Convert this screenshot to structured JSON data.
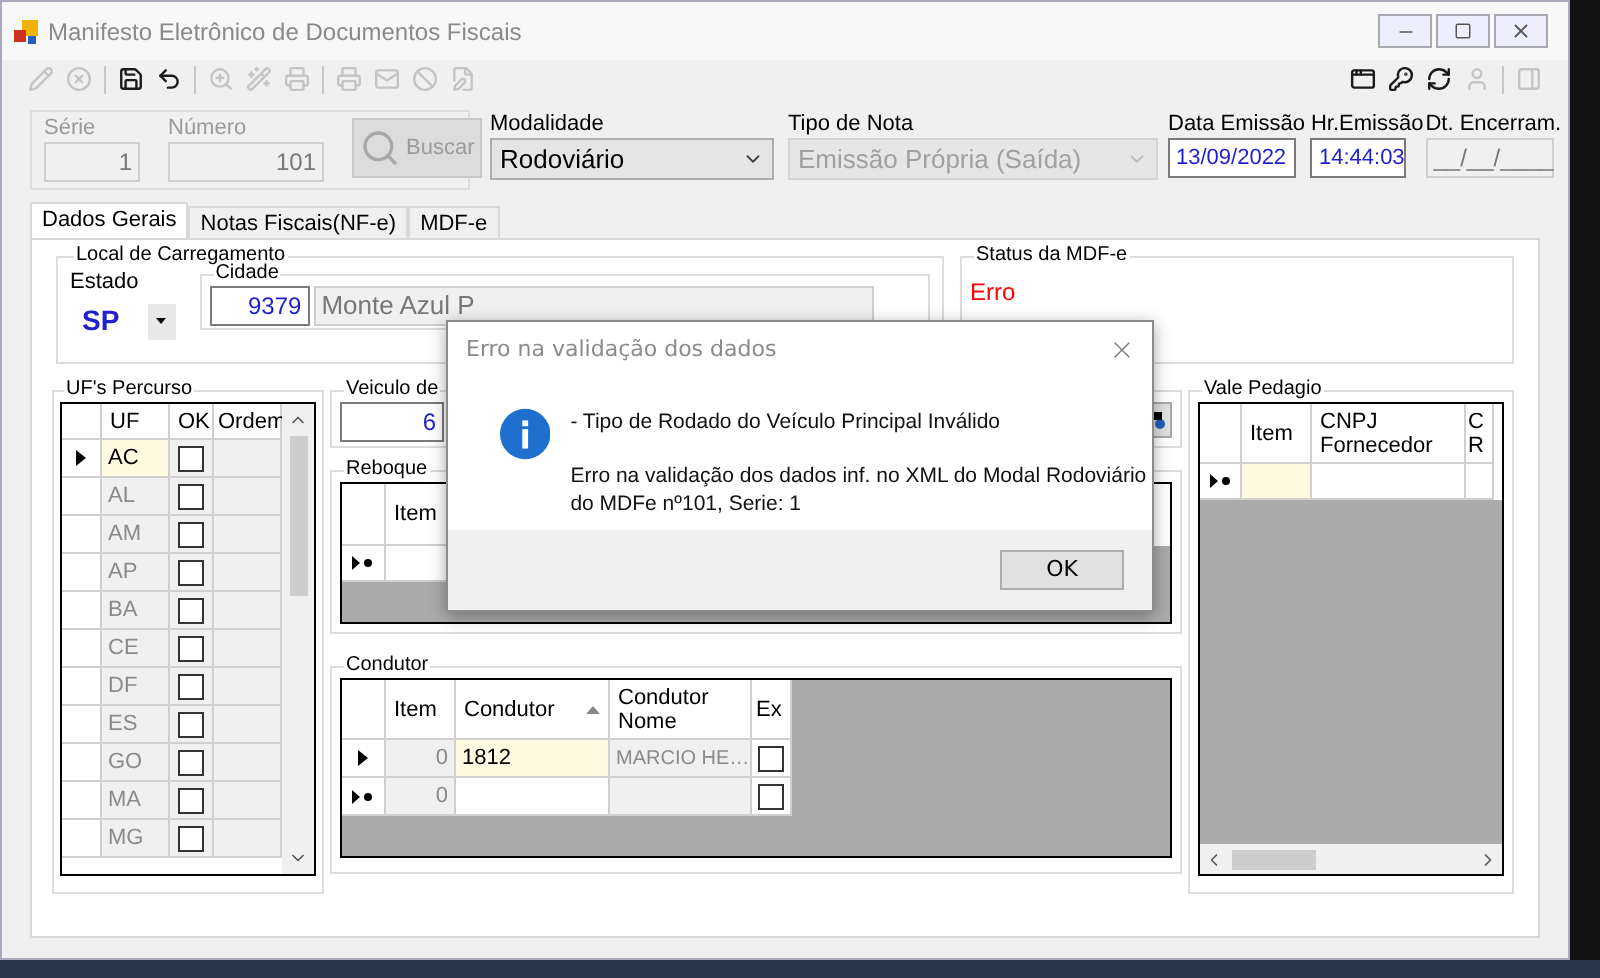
{
  "window": {
    "title": "Manifesto Eletrônico de Documentos Fiscais"
  },
  "toolbar": [
    {
      "kind": "edit",
      "disabled": true
    },
    {
      "kind": "cancel",
      "disabled": true
    },
    {
      "kind": "separator"
    },
    {
      "kind": "save",
      "disabled": false
    },
    {
      "kind": "undo",
      "disabled": false
    },
    {
      "kind": "separator"
    },
    {
      "kind": "zoom",
      "disabled": true
    },
    {
      "kind": "wand",
      "disabled": true
    },
    {
      "kind": "print",
      "disabled": true
    },
    {
      "kind": "separator"
    },
    {
      "kind": "print",
      "disabled": true
    },
    {
      "kind": "mail",
      "disabled": true
    },
    {
      "kind": "ban",
      "disabled": true
    },
    {
      "kind": "note",
      "disabled": true
    }
  ],
  "toolbar_right": [
    {
      "kind": "window",
      "disabled": false
    },
    {
      "kind": "key",
      "disabled": false
    },
    {
      "kind": "refresh",
      "disabled": false
    },
    {
      "kind": "user",
      "disabled": true
    },
    {
      "kind": "separator"
    },
    {
      "kind": "panel",
      "disabled": true
    }
  ],
  "header": {
    "serie": {
      "label": "Série",
      "value": "1",
      "disabled": true
    },
    "numero": {
      "label": "Número",
      "value": "101",
      "disabled": true
    },
    "search_button": {
      "label": "Buscar",
      "disabled": true
    },
    "modalidade": {
      "label": "Modalidade",
      "value": "Rodoviário",
      "disabled": false
    },
    "tipo_nota": {
      "label": "Tipo de Nota",
      "value": "Emissão Própria (Saída)",
      "disabled": true
    },
    "data_emissao": {
      "label": "Data Emissão",
      "value": "13/09/2022"
    },
    "hr_emissao": {
      "label": "Hr.Emissão",
      "value": "14:44:03"
    },
    "dt_encerram": {
      "label": "Dt. Encerram.",
      "value": "__/__/____"
    }
  },
  "tabs": [
    {
      "label": "Dados Gerais",
      "selected": true
    },
    {
      "label": "Notas Fiscais(NF-e)",
      "selected": false
    },
    {
      "label": "MDF-e",
      "selected": false
    }
  ],
  "local_carregamento": {
    "title": "Local de Carregamento",
    "estado_label": "Estado",
    "estado": "SP",
    "cidade_label": "Cidade",
    "cidade_code": "9379",
    "cidade_name": "Monte Azul P"
  },
  "status": {
    "title": "Status da MDF-e",
    "value": "Erro"
  },
  "ufs_percurso": {
    "title": "UF's Percurso",
    "columns": [
      "UF",
      "OK",
      "Ordem"
    ],
    "rows": [
      {
        "uf": "AC",
        "checked": false,
        "selected": true
      },
      {
        "uf": "AL",
        "checked": false,
        "selected": false
      },
      {
        "uf": "AM",
        "checked": false,
        "selected": false
      },
      {
        "uf": "AP",
        "checked": false,
        "selected": false
      },
      {
        "uf": "BA",
        "checked": false,
        "selected": false
      },
      {
        "uf": "CE",
        "checked": false,
        "selected": false
      },
      {
        "uf": "DF",
        "checked": false,
        "selected": false
      },
      {
        "uf": "ES",
        "checked": false,
        "selected": false
      },
      {
        "uf": "GO",
        "checked": false,
        "selected": false
      },
      {
        "uf": "MA",
        "checked": false,
        "selected": false
      },
      {
        "uf": "MG",
        "checked": false,
        "selected": false
      }
    ]
  },
  "veiculo": {
    "title": "Veiculo de",
    "value": "6"
  },
  "reboque": {
    "title": "Reboque",
    "columns": [
      "Item"
    ]
  },
  "condutor": {
    "title": "Condutor",
    "columns": [
      "Item",
      "Condutor",
      "Condutor Nome",
      "Ex"
    ],
    "rows": [
      {
        "kind": "current",
        "item": "0",
        "condutor": "1812",
        "nome": "MARCIO HE…",
        "checked": false
      },
      {
        "kind": "new",
        "item": "0",
        "checked": false
      }
    ]
  },
  "vale_pedagio": {
    "title": "Vale Pedagio",
    "columns": [
      "Item",
      "CNPJ Fornecedor",
      "C R"
    ]
  },
  "dialog": {
    "title": "Erro na validação dos dados",
    "messages": [
      "- Tipo de Rodado do Veículo Principal Inválido",
      "Erro na validação dos dados inf. no XML do Modal Rodoviário do MDFe nº101, Serie: 1"
    ],
    "button": "OK"
  }
}
